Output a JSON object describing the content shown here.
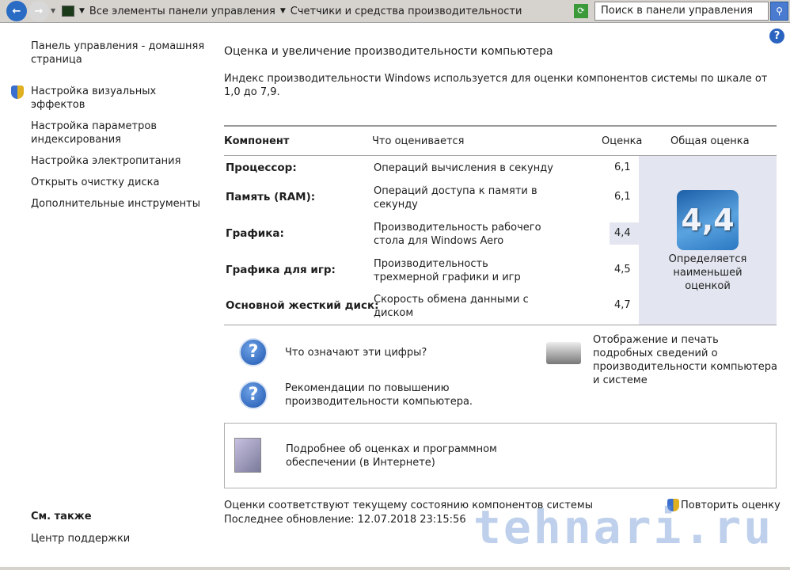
{
  "toolbar": {
    "breadcrumb": [
      "Все элементы панели управления",
      "Счетчики и средства производительности"
    ],
    "search_placeholder": "Поиск в панели управления"
  },
  "sidebar": {
    "items": [
      "Панель управления - домашняя страница",
      "Настройка визуальных эффектов",
      "Настройка параметров индексирования",
      "Настройка электропитания",
      "Открыть очистку диска",
      "Дополнительные инструменты"
    ],
    "see_also_title": "См. также",
    "see_also": [
      "Центр поддержки"
    ]
  },
  "main": {
    "title": "Оценка и увеличение производительности компьютера",
    "description": "Индекс производительности Windows используется для оценки компонентов системы по шкале от 1,0 до 7,9.",
    "headers": {
      "component": "Компонент",
      "what": "Что оценивается",
      "score": "Оценка",
      "base": "Общая оценка"
    },
    "rows": [
      {
        "component": "Процессор:",
        "what": "Операций вычисления в секунду",
        "score": "6,1"
      },
      {
        "component": "Память (RAM):",
        "what": "Операций доступа к памяти в секунду",
        "score": "6,1"
      },
      {
        "component": "Графика:",
        "what": "Производительность рабочего стола для Windows Aero",
        "score": "4,4"
      },
      {
        "component": "Графика для игр:",
        "what": "Производительность трехмерной графики и игр",
        "score": "4,5"
      },
      {
        "component": "Основной жесткий диск:",
        "what": "Скорость обмена данными с диском",
        "score": "4,7"
      }
    ],
    "base_score": "4,4",
    "base_note": "Определяется наименьшей оценкой",
    "links": {
      "what_numbers": "Что означают эти цифры?",
      "recommendations": "Рекомендации по повышению производительности компьютера.",
      "print": "Отображение и печать подробных сведений о производительности компьютера и системе",
      "more_info": "Подробнее об оценках и программном обеспечении (в Интернете)"
    },
    "status": "Оценки соответствуют текущему состоянию компонентов системы",
    "last_update": "Последнее обновление: 12.07.2018 23:15:56",
    "rerun": "Повторить оценку"
  },
  "watermark": "tehnari.ru"
}
